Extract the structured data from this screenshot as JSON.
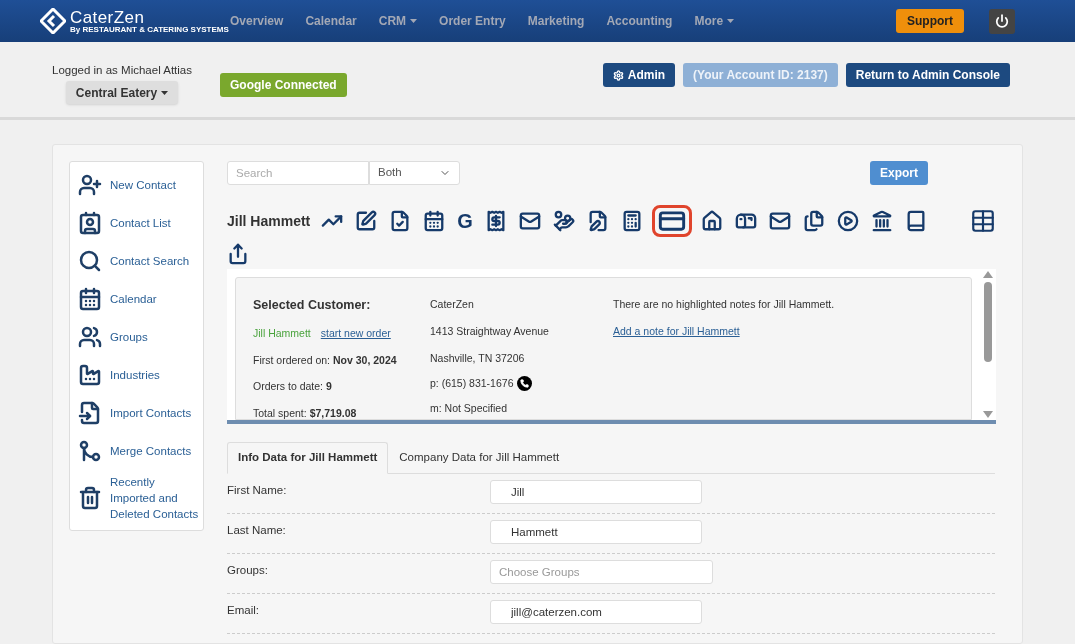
{
  "brand": {
    "name": "CaterZen",
    "tagline": "By RESTAURANT & CATERING SYSTEMS"
  },
  "nav": [
    {
      "label": "Overview",
      "dropdown": false
    },
    {
      "label": "Calendar",
      "dropdown": false
    },
    {
      "label": "CRM",
      "dropdown": true
    },
    {
      "label": "Order Entry",
      "dropdown": false
    },
    {
      "label": "Marketing",
      "dropdown": false
    },
    {
      "label": "Accounting",
      "dropdown": false
    },
    {
      "label": "More",
      "dropdown": true
    }
  ],
  "support": "Support",
  "account": {
    "logged_in": "Logged in as Michael Attias",
    "location": "Central Eatery",
    "google": "Google Connected",
    "admin": "Admin",
    "account_id": "(Your Account ID: 2137)",
    "return": "Return to Admin Console"
  },
  "sidebar": {
    "items": [
      {
        "label": "New Contact"
      },
      {
        "label": "Contact List"
      },
      {
        "label": "Contact Search"
      },
      {
        "label": "Calendar"
      },
      {
        "label": "Groups"
      },
      {
        "label": "Industries"
      },
      {
        "label": "Import Contacts"
      },
      {
        "label": "Merge Contacts"
      },
      {
        "label": "Recently Imported and Deleted Contacts"
      }
    ]
  },
  "search": {
    "placeholder": "Search",
    "scope": "Both"
  },
  "export": "Export",
  "contact_name": "Jill Hammett",
  "toolbar": [
    {
      "highlighted": false
    },
    {
      "highlighted": false
    },
    {
      "highlighted": false
    },
    {
      "highlighted": false
    },
    {
      "highlighted": false
    },
    {
      "highlighted": false
    },
    {
      "highlighted": false
    },
    {
      "highlighted": false
    },
    {
      "highlighted": false
    },
    {
      "highlighted": false
    },
    {
      "highlighted": true
    },
    {
      "highlighted": false
    },
    {
      "highlighted": false
    },
    {
      "highlighted": false
    },
    {
      "highlighted": false
    },
    {
      "highlighted": false
    },
    {
      "highlighted": false
    },
    {
      "highlighted": false
    }
  ],
  "google_glyph": "G",
  "summary": {
    "heading": "Selected Customer:",
    "name": "Jill Hammett",
    "new_order": "start new order",
    "stats": [
      {
        "label": "First ordered on:",
        "value": "Nov 30, 2024"
      },
      {
        "label": "Orders to date:",
        "value": "9"
      },
      {
        "label": "Total spent:",
        "value": "$7,719.08"
      }
    ],
    "company": "CaterZen",
    "address": "1413 Straightway Avenue",
    "city": "Nashville, TN 37206",
    "phone": "p: (615) 831-1676",
    "mobile": "m: Not Specified",
    "notes": "There are no highlighted notes for Jill Hammett.",
    "add_note": "Add a note for Jill Hammett"
  },
  "tabs": [
    {
      "label": "Info Data for Jill Hammett",
      "selected": true
    },
    {
      "label": "Company Data for Jill Hammett",
      "selected": false
    }
  ],
  "fields": [
    {
      "label": "First Name:",
      "value": "Jill"
    },
    {
      "label": "Last Name:",
      "value": "Hammett"
    },
    {
      "label": "Groups:",
      "placeholder": "Choose Groups"
    },
    {
      "label": "Email:",
      "value": "jill@caterzen.com"
    }
  ]
}
